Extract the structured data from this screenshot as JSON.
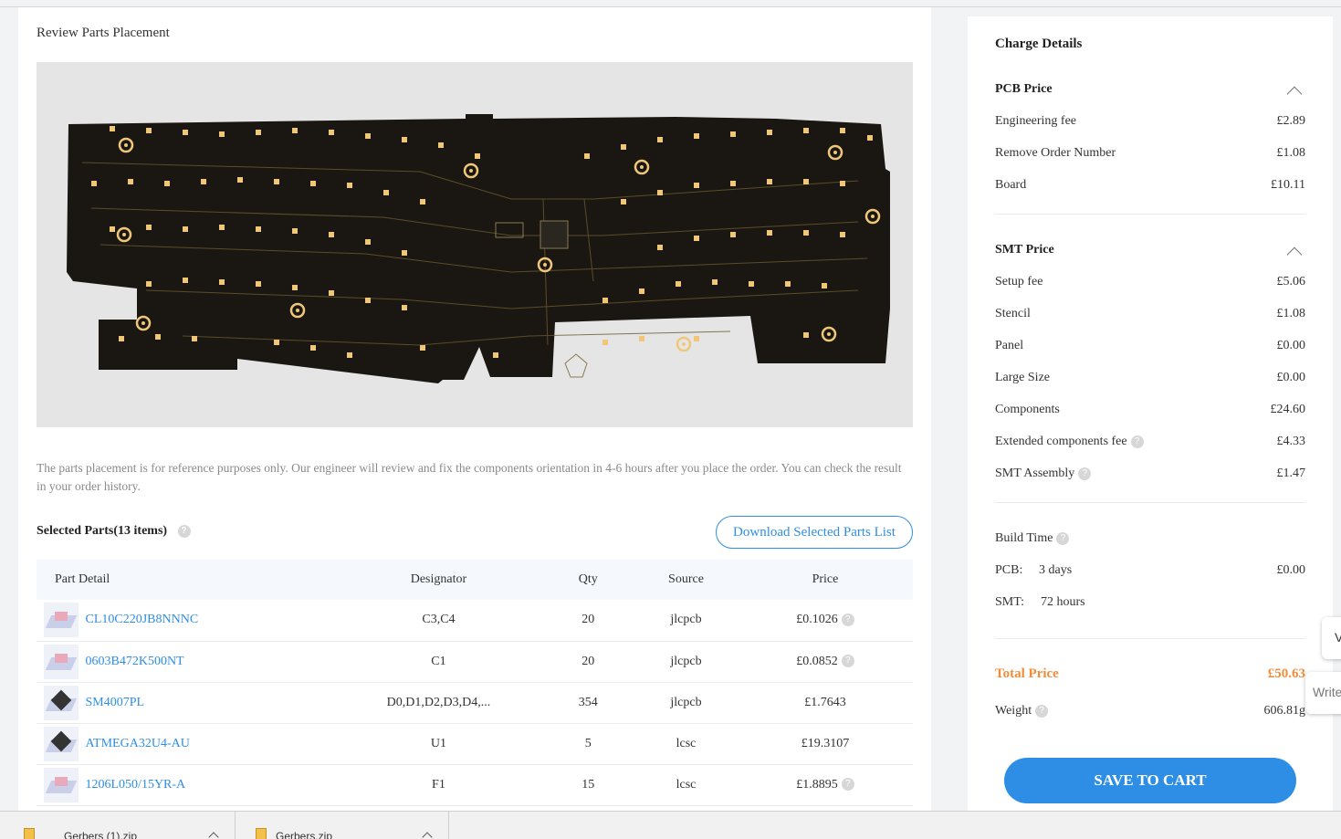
{
  "review": {
    "title": "Review Parts Placement",
    "note": "The parts placement is for reference purposes only. Our engineer will review and fix the components orientation in 4-6 hours after you place the order. You can check the result in your order history."
  },
  "parts": {
    "title": "Selected Parts(13 items)",
    "download_label": "Download Selected Parts List",
    "columns": [
      "Part Detail",
      "Designator",
      "Qty",
      "Source",
      "Price"
    ],
    "rows": [
      {
        "part": "CL10C220JB8NNNC",
        "designator": "C3,C4",
        "qty": "20",
        "source": "jlcpcb",
        "price": "£0.1026",
        "help": true,
        "thumb": "cap"
      },
      {
        "part": "0603B472K500NT",
        "designator": "C1",
        "qty": "20",
        "source": "jlcpcb",
        "price": "£0.0852",
        "help": true,
        "thumb": "cap"
      },
      {
        "part": "SM4007PL",
        "designator": "D0,D1,D2,D3,D4,...",
        "qty": "354",
        "source": "jlcpcb",
        "price": "£1.7643",
        "help": false,
        "thumb": "diode"
      },
      {
        "part": "ATMEGA32U4-AU",
        "designator": "U1",
        "qty": "5",
        "source": "lcsc",
        "price": "£19.3107",
        "help": false,
        "thumb": "chip"
      },
      {
        "part": "1206L050/15YR-A",
        "designator": "F1",
        "qty": "15",
        "source": "lcsc",
        "price": "£1.8895",
        "help": true,
        "thumb": "fuse"
      }
    ]
  },
  "charge": {
    "title": "Charge Details",
    "pcb_price": {
      "title": "PCB Price",
      "items": [
        {
          "label": "Engineering fee",
          "value": "£2.89"
        },
        {
          "label": "Remove Order Number",
          "value": "£1.08"
        },
        {
          "label": "Board",
          "value": "£10.11"
        }
      ]
    },
    "smt_price": {
      "title": "SMT Price",
      "items": [
        {
          "label": "Setup fee",
          "value": "£5.06"
        },
        {
          "label": "Stencil",
          "value": "£1.08"
        },
        {
          "label": "Panel",
          "value": "£0.00"
        },
        {
          "label": "Large Size",
          "value": "£0.00"
        },
        {
          "label": "Components",
          "value": "£24.60"
        },
        {
          "label": "Extended components fee",
          "value": "£4.33"
        },
        {
          "label": "SMT Assembly",
          "value": "£1.47"
        }
      ]
    },
    "build_time": {
      "title": "Build Time",
      "pcb_label": "PCB:",
      "pcb_value": "3 days",
      "pcb_price": "£0.00",
      "smt_label": "SMT:",
      "smt_value": "72 hours"
    },
    "total_label": "Total Price",
    "total_value": "£50.63",
    "weight_label": "Weight",
    "weight_value": "606.81g",
    "save_label": "SAVE TO CART"
  },
  "edge": {
    "widget1": "V",
    "widget2": "Write"
  },
  "downloads": [
    {
      "name": "Gerbers (1).zip"
    },
    {
      "name": "Gerbers.zip"
    }
  ],
  "colors": {
    "accent": "#2e8ee6",
    "total": "#f08d3c",
    "pcb": "#1a1712",
    "pad": "#f0c77a"
  }
}
